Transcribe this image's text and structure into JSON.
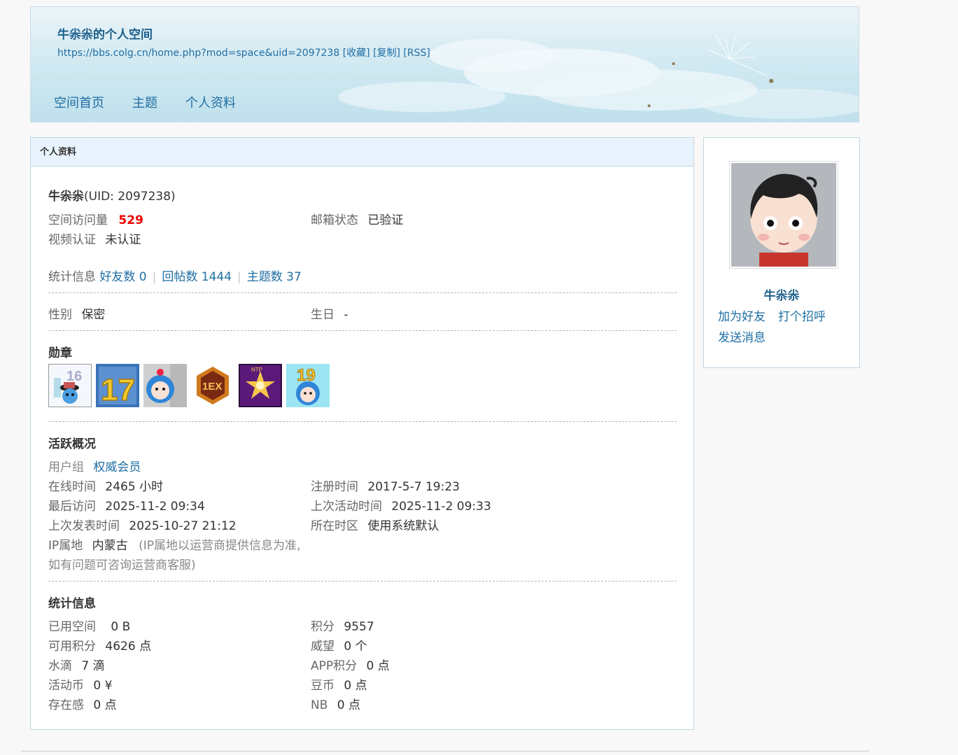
{
  "header": {
    "title": "牛尜尜的个人空间",
    "url": "https://bbs.colg.cn/home.php?mod=space&uid=2097238",
    "url_links": [
      "[收藏]",
      "[复制]",
      "[RSS]"
    ],
    "nav": [
      "空间首页",
      "主题",
      "个人资料"
    ]
  },
  "panel": {
    "title": "个人资料",
    "username": "牛尜尜",
    "uid_text": "(UID: 2097238)",
    "visits_label": "空间访问量",
    "visits_value": "529",
    "email_label": "邮箱状态",
    "email_value": "已验证",
    "video_label": "视频认证",
    "video_value": "未认证",
    "stats_label": "统计信息",
    "stats_links": [
      "好友数 0",
      "回帖数 1444",
      "主题数 37"
    ],
    "gender_label": "性别",
    "gender_value": "保密",
    "birthday_label": "生日",
    "birthday_value": "-",
    "medals_title": "勋章",
    "medal_icons": [
      "medal-16-icon",
      "medal-17-icon",
      "medal-mascot-icon",
      "medal-ex-icon",
      "medal-star-icon",
      "medal-19-icon"
    ],
    "activity_title": "活跃概况",
    "usergroup_label": "用户组",
    "usergroup_value": "权威会员",
    "online_label": "在线时间",
    "online_value": "2465 小时",
    "register_label": "注册时间",
    "register_value": "2017-5-7 19:23",
    "lastvisit_label": "最后访问",
    "lastvisit_value": "2025-11-2 09:34",
    "lastactive_label": "上次活动时间",
    "lastactive_value": "2025-11-2 09:33",
    "lastpost_label": "上次发表时间",
    "lastpost_value": "2025-10-27 21:12",
    "timezone_label": "所在时区",
    "timezone_value": "使用系统默认",
    "ip_label": "IP属地",
    "ip_value": "内蒙古",
    "ip_note_1": "(IP属地以运营商提供信息为准,",
    "ip_note_2": "如有问题可咨询运营商客服)",
    "statistics_title": "统计信息",
    "space_used_label": "已用空间",
    "space_used_value": "0 B",
    "points_label": "积分",
    "points_value": "9557",
    "available_label": "可用积分",
    "available_value": "4626 点",
    "prestige_label": "威望",
    "prestige_value": "0 个",
    "drops_label": "水滴",
    "drops_value": "7 滴",
    "app_label": "APP积分",
    "app_value": "0 点",
    "coin_label": "活动币",
    "coin_value": "0 ¥",
    "bean_label": "豆币",
    "bean_value": "0 点",
    "presence_label": "存在感",
    "presence_value": "0 点",
    "nb_label": "NB",
    "nb_value": "0 点"
  },
  "sidebar": {
    "name": "牛尜尜",
    "add_friend": "加为好友",
    "greet": "打个招呼",
    "message": "发送消息"
  }
}
